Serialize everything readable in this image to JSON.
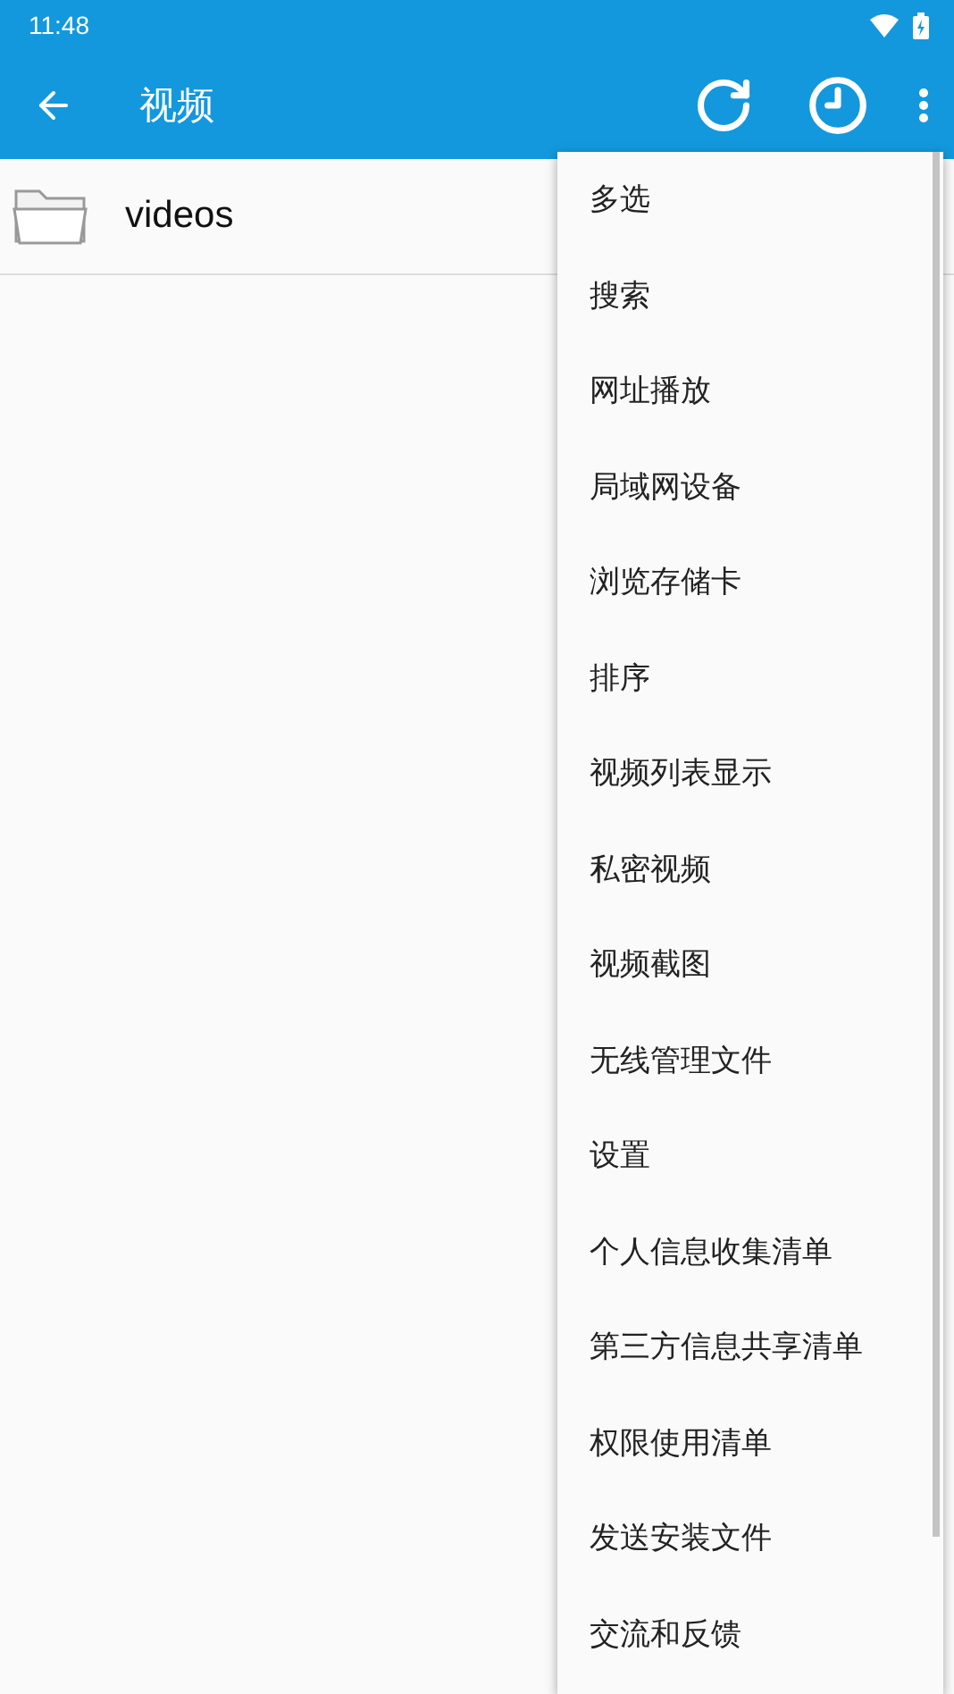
{
  "status_bar": {
    "time": "11:48"
  },
  "app_bar": {
    "title": "视频"
  },
  "files": [
    {
      "name": "videos",
      "kind": "folder"
    }
  ],
  "menu": {
    "items": [
      "多选",
      "搜索",
      "网址播放",
      "局域网设备",
      "浏览存储卡",
      "排序",
      "视频列表显示",
      "私密视频",
      "视频截图",
      "无线管理文件",
      "设置",
      "个人信息收集清单",
      "第三方信息共享清单",
      "权限使用清单",
      "发送安装文件",
      "交流和反馈"
    ]
  }
}
